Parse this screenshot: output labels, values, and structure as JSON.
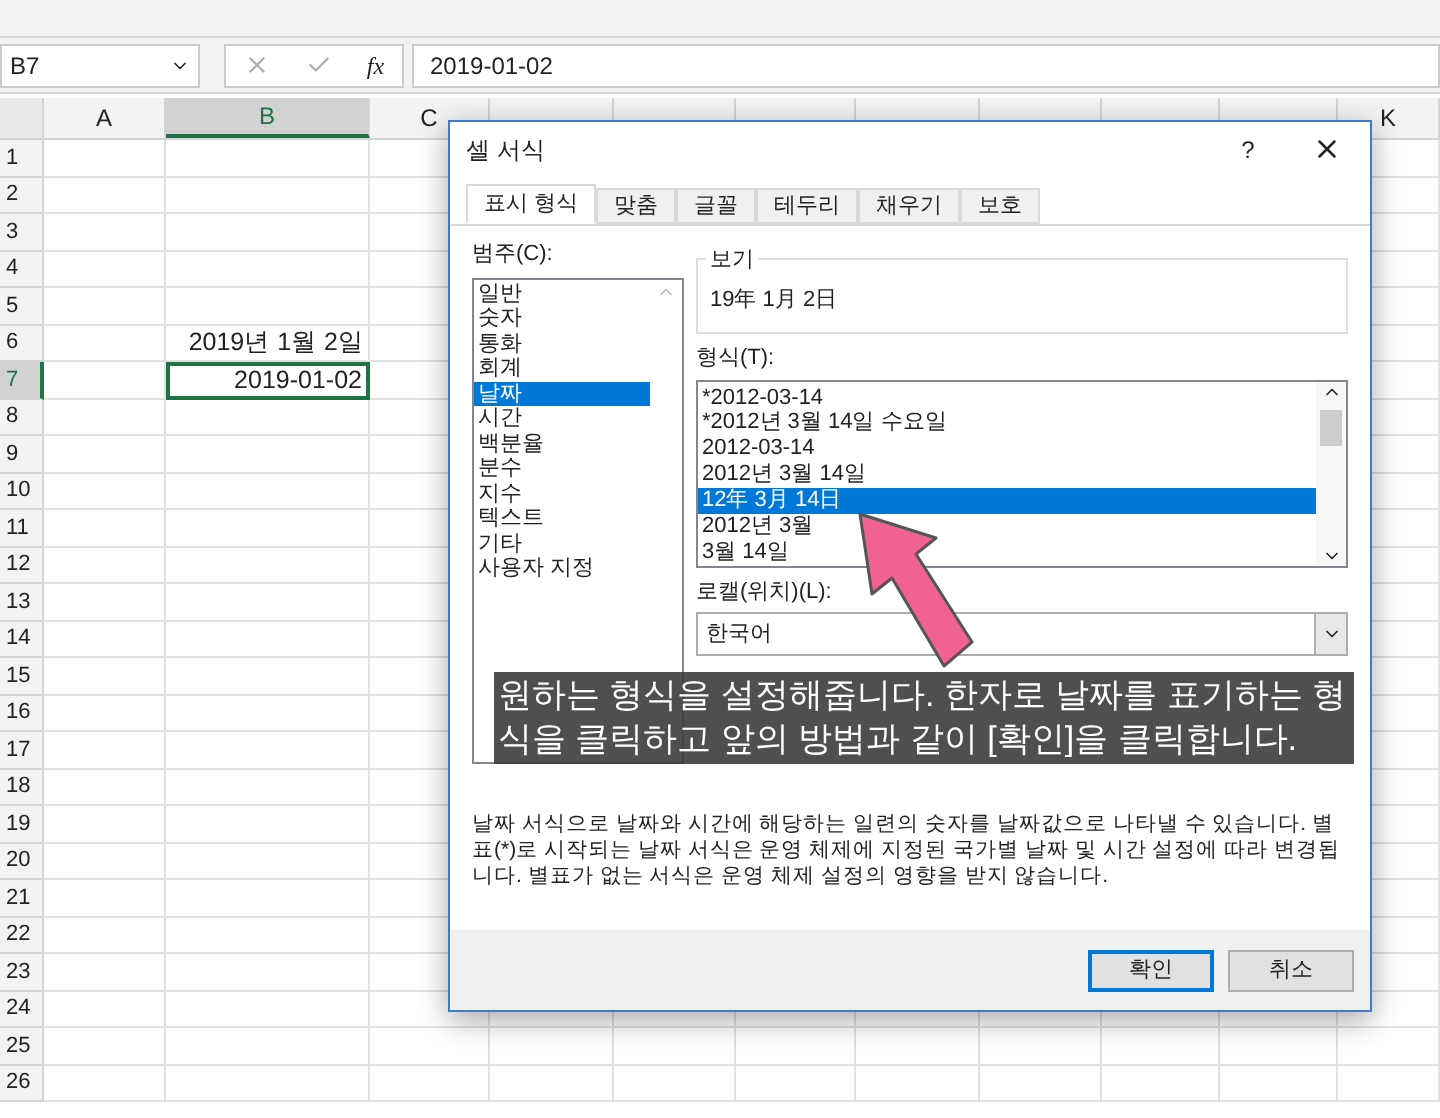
{
  "name_box": "B7",
  "formula_bar": {
    "function_label": "fx",
    "value": "2019-01-02"
  },
  "columns": [
    {
      "label": "A",
      "selected": false
    },
    {
      "label": "B",
      "selected": true
    },
    {
      "label": "C",
      "selected": false
    },
    {
      "selected": false
    },
    {
      "selected": false
    },
    {
      "selected": false
    },
    {
      "selected": false
    },
    {
      "selected": false
    },
    {
      "selected": false
    },
    {
      "selected": false
    },
    {
      "label": "K",
      "selected": false
    }
  ],
  "rows": [
    {
      "label": "1",
      "selected": false
    },
    {
      "label": "2",
      "selected": false
    },
    {
      "label": "3",
      "selected": false
    },
    {
      "label": "4",
      "selected": false
    },
    {
      "label": "5",
      "selected": false
    },
    {
      "label": "6",
      "selected": false,
      "cell_b": {
        "value": "2019년 1월 2일",
        "selected": false
      }
    },
    {
      "label": "7",
      "selected": true,
      "cell_b": {
        "value": "2019-01-02",
        "selected": true
      }
    },
    {
      "label": "8",
      "selected": false
    },
    {
      "label": "9",
      "selected": false
    },
    {
      "label": "10",
      "selected": false
    },
    {
      "label": "11",
      "selected": false
    },
    {
      "label": "12",
      "selected": false
    },
    {
      "label": "13",
      "selected": false
    },
    {
      "label": "14",
      "selected": false
    },
    {
      "label": "15",
      "selected": false
    },
    {
      "label": "16",
      "selected": false
    },
    {
      "label": "17",
      "selected": false
    },
    {
      "label": "18",
      "selected": false
    },
    {
      "label": "19",
      "selected": false
    },
    {
      "label": "20",
      "selected": false
    },
    {
      "label": "21",
      "selected": false
    },
    {
      "label": "22",
      "selected": false
    },
    {
      "label": "23",
      "selected": false
    },
    {
      "label": "24",
      "selected": false
    },
    {
      "label": "25",
      "selected": false
    },
    {
      "label": "26",
      "selected": false
    }
  ],
  "dialog": {
    "title": "셀 서식",
    "help": "?",
    "tabs": [
      {
        "label": "표시 형식",
        "selected": true
      },
      {
        "label": "맞춤",
        "selected": false
      },
      {
        "label": "글꼴",
        "selected": false
      },
      {
        "label": "테두리",
        "selected": false
      },
      {
        "label": "채우기",
        "selected": false
      },
      {
        "label": "보호",
        "selected": false
      }
    ],
    "category_label": "범주(C):",
    "categories": [
      {
        "label": "일반",
        "selected": false
      },
      {
        "label": "숫자",
        "selected": false
      },
      {
        "label": "통화",
        "selected": false
      },
      {
        "label": "회계",
        "selected": false
      },
      {
        "label": "날짜",
        "selected": true
      },
      {
        "label": "시간",
        "selected": false
      },
      {
        "label": "백분율",
        "selected": false
      },
      {
        "label": "분수",
        "selected": false
      },
      {
        "label": "지수",
        "selected": false
      },
      {
        "label": "텍스트",
        "selected": false
      },
      {
        "label": "기타",
        "selected": false
      },
      {
        "label": "사용자 지정",
        "selected": false
      }
    ],
    "sample": {
      "label": "보기",
      "value": "19年 1月 2日"
    },
    "type_label": "형식(T):",
    "types": [
      {
        "label": "*2012-03-14",
        "selected": false
      },
      {
        "label": "*2012년 3월 14일 수요일",
        "selected": false
      },
      {
        "label": "2012-03-14",
        "selected": false
      },
      {
        "label": "2012년 3월 14일",
        "selected": false
      },
      {
        "label": "12年 3月 14日",
        "selected": true
      },
      {
        "label": "2012년 3월",
        "selected": false
      },
      {
        "label": "3월 14일",
        "selected": false
      }
    ],
    "locale_label": "로캘(위치)(L):",
    "locale_value": "한국어",
    "description": "날짜 서식으로 날짜와 시간에 해당하는 일련의 숫자를 날짜값으로 나타낼 수 있습니다. 별표(*)로 시작되는 날짜 서식은 운영 체제에 지정된 국가별 날짜 및 시간 설정에 따라 변경됩니다. 별표가 없는 서식은 운영 체제 설정의 영향을 받지 않습니다.",
    "buttons": [
      {
        "label": "확인",
        "default": true
      },
      {
        "label": "취소",
        "default": false
      }
    ]
  },
  "caption": "원하는 형식을 설정해줍니다. 한자로 날짜를 표기하는 형식을 클릭하고 앞의 방법과 같이 [확인]을 클릭합니다."
}
